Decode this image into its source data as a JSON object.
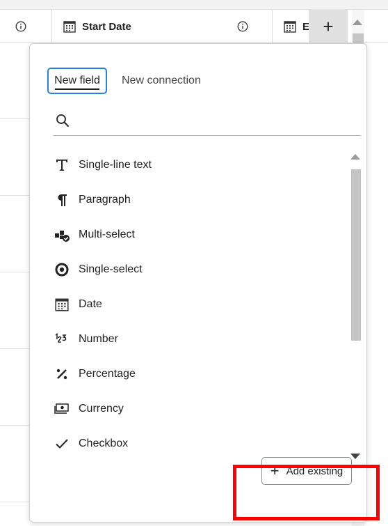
{
  "table": {
    "columns": [
      {
        "title": "Start Date"
      },
      {
        "title": "E"
      }
    ],
    "add_column_glyph": "+"
  },
  "popover": {
    "tabs": [
      {
        "label": "New field",
        "selected": true
      },
      {
        "label": "New connection",
        "selected": false
      }
    ],
    "search": {
      "placeholder": "",
      "value": ""
    },
    "field_types": [
      {
        "label": "Single-line text",
        "icon": "text-t-icon"
      },
      {
        "label": "Paragraph",
        "icon": "pilcrow-icon"
      },
      {
        "label": "Multi-select",
        "icon": "multi-select-icon"
      },
      {
        "label": "Single-select",
        "icon": "radio-target-icon"
      },
      {
        "label": "Date",
        "icon": "calendar-icon"
      },
      {
        "label": "Number",
        "icon": "number-123-icon"
      },
      {
        "label": "Percentage",
        "icon": "percent-icon"
      },
      {
        "label": "Currency",
        "icon": "currency-bill-icon"
      },
      {
        "label": "Checkbox",
        "icon": "checkmark-icon"
      }
    ],
    "add_existing": {
      "glyph": "+",
      "label": "Add existing"
    }
  },
  "colors": {
    "accent": "#2680eb",
    "highlight": "#ff0000",
    "text": "#222222"
  }
}
